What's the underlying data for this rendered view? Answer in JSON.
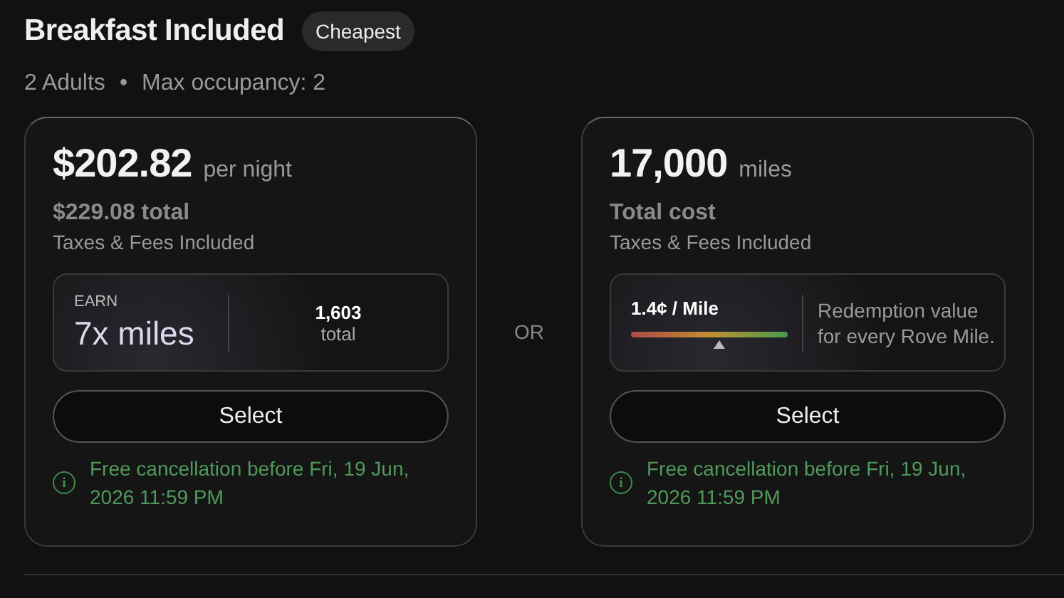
{
  "title": "Breakfast Included",
  "badge": "Cheapest",
  "guests": "2 Adults",
  "separator": "•",
  "occupancy": "Max occupancy: 2",
  "divider_label": "OR",
  "options": [
    {
      "kind": "cash",
      "amount": "$202.82",
      "unit": "per night",
      "total": "$229.08 total",
      "note": "Taxes & Fees Included",
      "earn_label": "EARN",
      "earn_value": "7x miles",
      "earn_total": "1,603",
      "earn_total_label": "total",
      "button": "Select",
      "cancellation": "Free cancellation before Fri, 19 Jun, 2026 11:59 PM",
      "info_icon": "i"
    },
    {
      "kind": "miles",
      "amount": "17,000",
      "unit": "miles",
      "total": "Total cost",
      "note": "Taxes & Fees Included",
      "rate": "1.4¢ / Mile",
      "level": 0.56,
      "rate_note": "Redemption value for every Rove Mile.",
      "button": "Select",
      "cancellation": "Free cancellation before Fri, 19 Jun, 2026 11:59 PM",
      "info_icon": "i"
    }
  ]
}
